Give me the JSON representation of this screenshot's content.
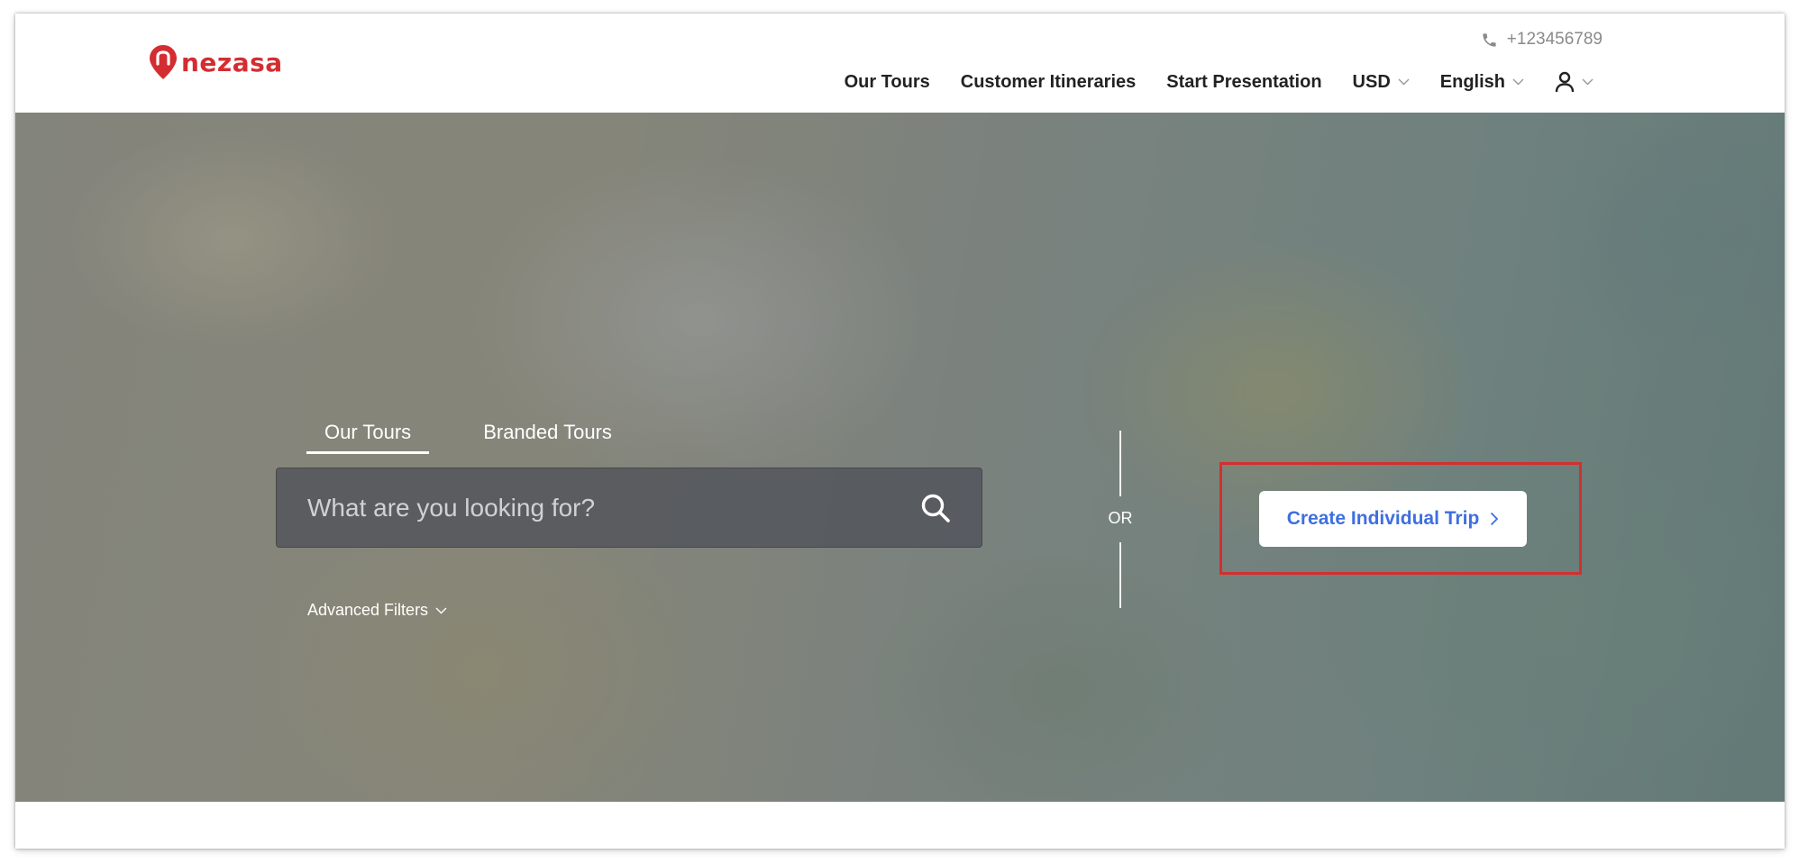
{
  "header": {
    "logo_text": "nezasa",
    "phone": "+123456789",
    "nav": {
      "our_tours": "Our Tours",
      "customer_itineraries": "Customer Itineraries",
      "start_presentation": "Start Presentation",
      "currency": "USD",
      "language": "English"
    }
  },
  "hero": {
    "tabs": [
      "Our Tours",
      "Branded Tours"
    ],
    "active_tab": "Our Tours",
    "search_placeholder": "What are you looking for?",
    "advanced_filters": "Advanced Filters",
    "or_label": "OR",
    "cta_label": "Create Individual Trip"
  },
  "colors": {
    "brand_red": "#d42d31",
    "cta_blue": "#3e6fe0",
    "highlight_red": "#d32f2f"
  },
  "icons": {
    "phone": "phone-icon",
    "chevron": "chevron-down-icon",
    "user": "user-icon",
    "search": "search-icon",
    "cta_arrow": "chevron-right-icon"
  }
}
